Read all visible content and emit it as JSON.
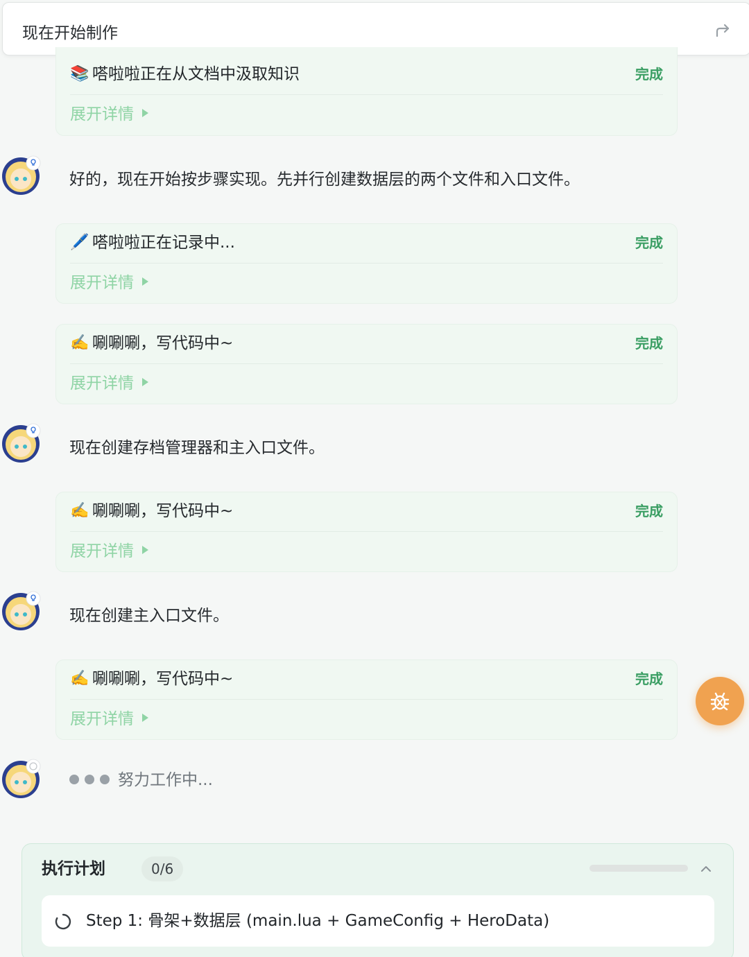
{
  "header": {
    "title": "现在开始制作",
    "share_icon": "share-forward-icon"
  },
  "cards": [
    {
      "emoji": "📚",
      "label": "嗒啦啦正在从文档中汲取知识",
      "status": "完成",
      "expand": "展开详情"
    },
    {
      "emoji": "🖊️",
      "label": "嗒啦啦正在记录中...",
      "status": "完成",
      "expand": "展开详情"
    },
    {
      "emoji": "✍️",
      "label": "唰唰唰，写代码中~",
      "status": "完成",
      "expand": "展开详情"
    },
    {
      "emoji": "✍️",
      "label": "唰唰唰，写代码中~",
      "status": "完成",
      "expand": "展开详情"
    },
    {
      "emoji": "✍️",
      "label": "唰唰唰，写代码中~",
      "status": "完成",
      "expand": "展开详情"
    }
  ],
  "messages": [
    {
      "text": "好的，现在开始按步骤实现。先并行创建数据层的两个文件和入口文件。"
    },
    {
      "text": "现在创建存档管理器和主入口文件。"
    },
    {
      "text": "现在创建主入口文件。"
    }
  ],
  "working": {
    "text": "努力工作中..."
  },
  "fab": {
    "icon": "bug-icon"
  },
  "plan": {
    "title": "执行计划",
    "count": "0/6",
    "progress": 0,
    "step": "Step 1: 骨架+数据层 (main.lua + GameConfig + HeroData)"
  },
  "colors": {
    "success": "#3a9e63",
    "expand": "#8fd4a5",
    "fab": "#f0a250",
    "avatar_ring": "#2b3f8f"
  }
}
